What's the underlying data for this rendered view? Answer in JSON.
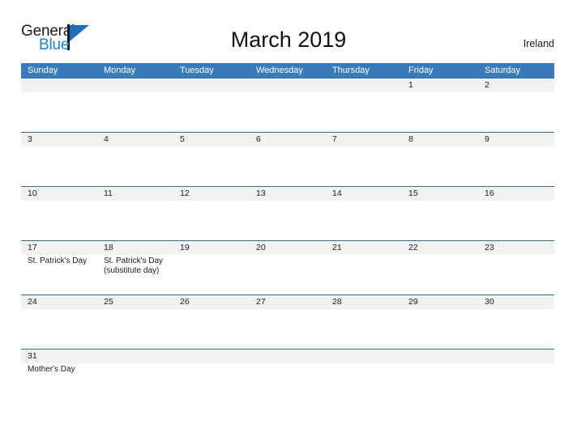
{
  "brand": {
    "name_part1": "General",
    "name_part2": "Blue",
    "accent_color": "#1f7fd0",
    "triangle_color": "#1a6fb5"
  },
  "header": {
    "title": "March 2019",
    "region": "Ireland"
  },
  "theme": {
    "header_band": "#3a7ab8",
    "row_border": "#2e6da4",
    "date_band": "#f2f2f2",
    "text": "#1b1b1b"
  },
  "weekdays": [
    "Sunday",
    "Monday",
    "Tuesday",
    "Wednesday",
    "Thursday",
    "Friday",
    "Saturday"
  ],
  "weeks": [
    {
      "days": [
        {
          "num": "",
          "events": ""
        },
        {
          "num": "",
          "events": ""
        },
        {
          "num": "",
          "events": ""
        },
        {
          "num": "",
          "events": ""
        },
        {
          "num": "",
          "events": ""
        },
        {
          "num": "1",
          "events": ""
        },
        {
          "num": "2",
          "events": ""
        }
      ]
    },
    {
      "days": [
        {
          "num": "3",
          "events": ""
        },
        {
          "num": "4",
          "events": ""
        },
        {
          "num": "5",
          "events": ""
        },
        {
          "num": "6",
          "events": ""
        },
        {
          "num": "7",
          "events": ""
        },
        {
          "num": "8",
          "events": ""
        },
        {
          "num": "9",
          "events": ""
        }
      ]
    },
    {
      "days": [
        {
          "num": "10",
          "events": ""
        },
        {
          "num": "11",
          "events": ""
        },
        {
          "num": "12",
          "events": ""
        },
        {
          "num": "13",
          "events": ""
        },
        {
          "num": "14",
          "events": ""
        },
        {
          "num": "15",
          "events": ""
        },
        {
          "num": "16",
          "events": ""
        }
      ]
    },
    {
      "days": [
        {
          "num": "17",
          "events": "St. Patrick's Day"
        },
        {
          "num": "18",
          "events": "St. Patrick's Day\n(substitute day)"
        },
        {
          "num": "19",
          "events": ""
        },
        {
          "num": "20",
          "events": ""
        },
        {
          "num": "21",
          "events": ""
        },
        {
          "num": "22",
          "events": ""
        },
        {
          "num": "23",
          "events": ""
        }
      ]
    },
    {
      "days": [
        {
          "num": "24",
          "events": ""
        },
        {
          "num": "25",
          "events": ""
        },
        {
          "num": "26",
          "events": ""
        },
        {
          "num": "27",
          "events": ""
        },
        {
          "num": "28",
          "events": ""
        },
        {
          "num": "29",
          "events": ""
        },
        {
          "num": "30",
          "events": ""
        }
      ]
    },
    {
      "days": [
        {
          "num": "31",
          "events": "Mother's Day"
        },
        {
          "num": "",
          "events": ""
        },
        {
          "num": "",
          "events": ""
        },
        {
          "num": "",
          "events": ""
        },
        {
          "num": "",
          "events": ""
        },
        {
          "num": "",
          "events": ""
        },
        {
          "num": "",
          "events": ""
        }
      ]
    }
  ]
}
